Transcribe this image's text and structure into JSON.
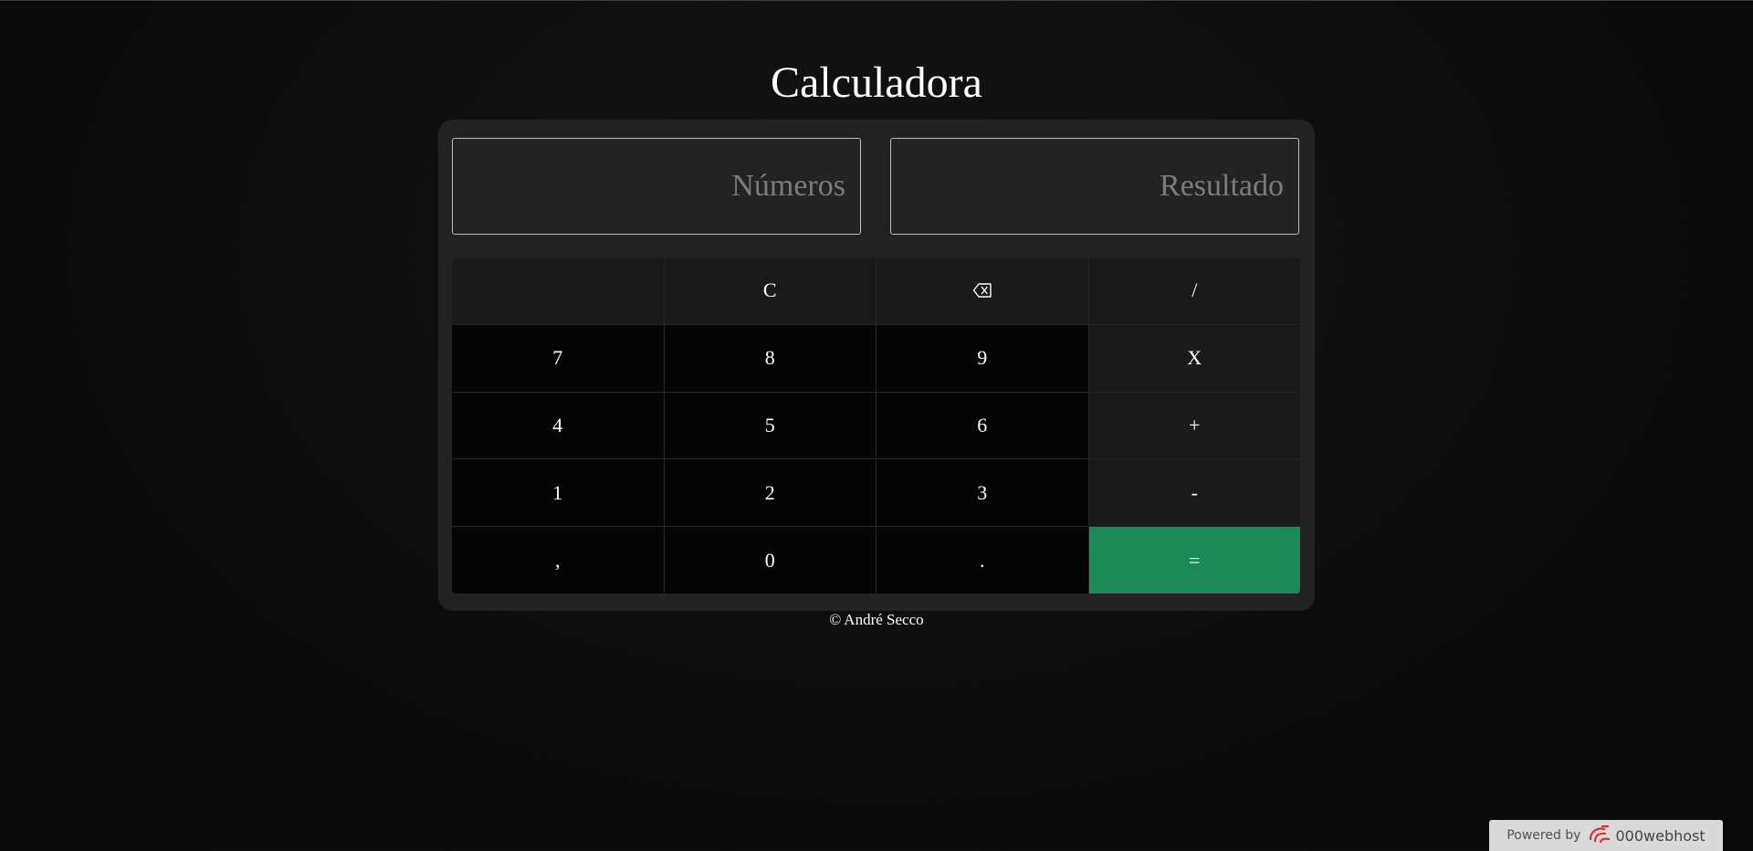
{
  "page": {
    "title": "Calculadora"
  },
  "displays": {
    "numbers_placeholder": "Números",
    "result_placeholder": "Resultado"
  },
  "keys": {
    "clear": "C",
    "divide": "/",
    "seven": "7",
    "eight": "8",
    "nine": "9",
    "multiply": "X",
    "four": "4",
    "five": "5",
    "six": "6",
    "plus": "+",
    "one": "1",
    "two": "2",
    "three": "3",
    "minus": "-",
    "comma": ",",
    "zero": "0",
    "dot": ".",
    "equals": "="
  },
  "icons": {
    "backspace": "backspace-icon",
    "host_logo": "000webhost-logo-icon"
  },
  "footer": {
    "copyright_symbol": "©",
    "author": "André Secco"
  },
  "hosting_badge": {
    "label": "Powered by",
    "name": "000webhost"
  },
  "colors": {
    "accent_equals": "#1b8a57",
    "panel": "#222222",
    "key_dark": "#050505",
    "key_function": "#1a1a1a"
  }
}
